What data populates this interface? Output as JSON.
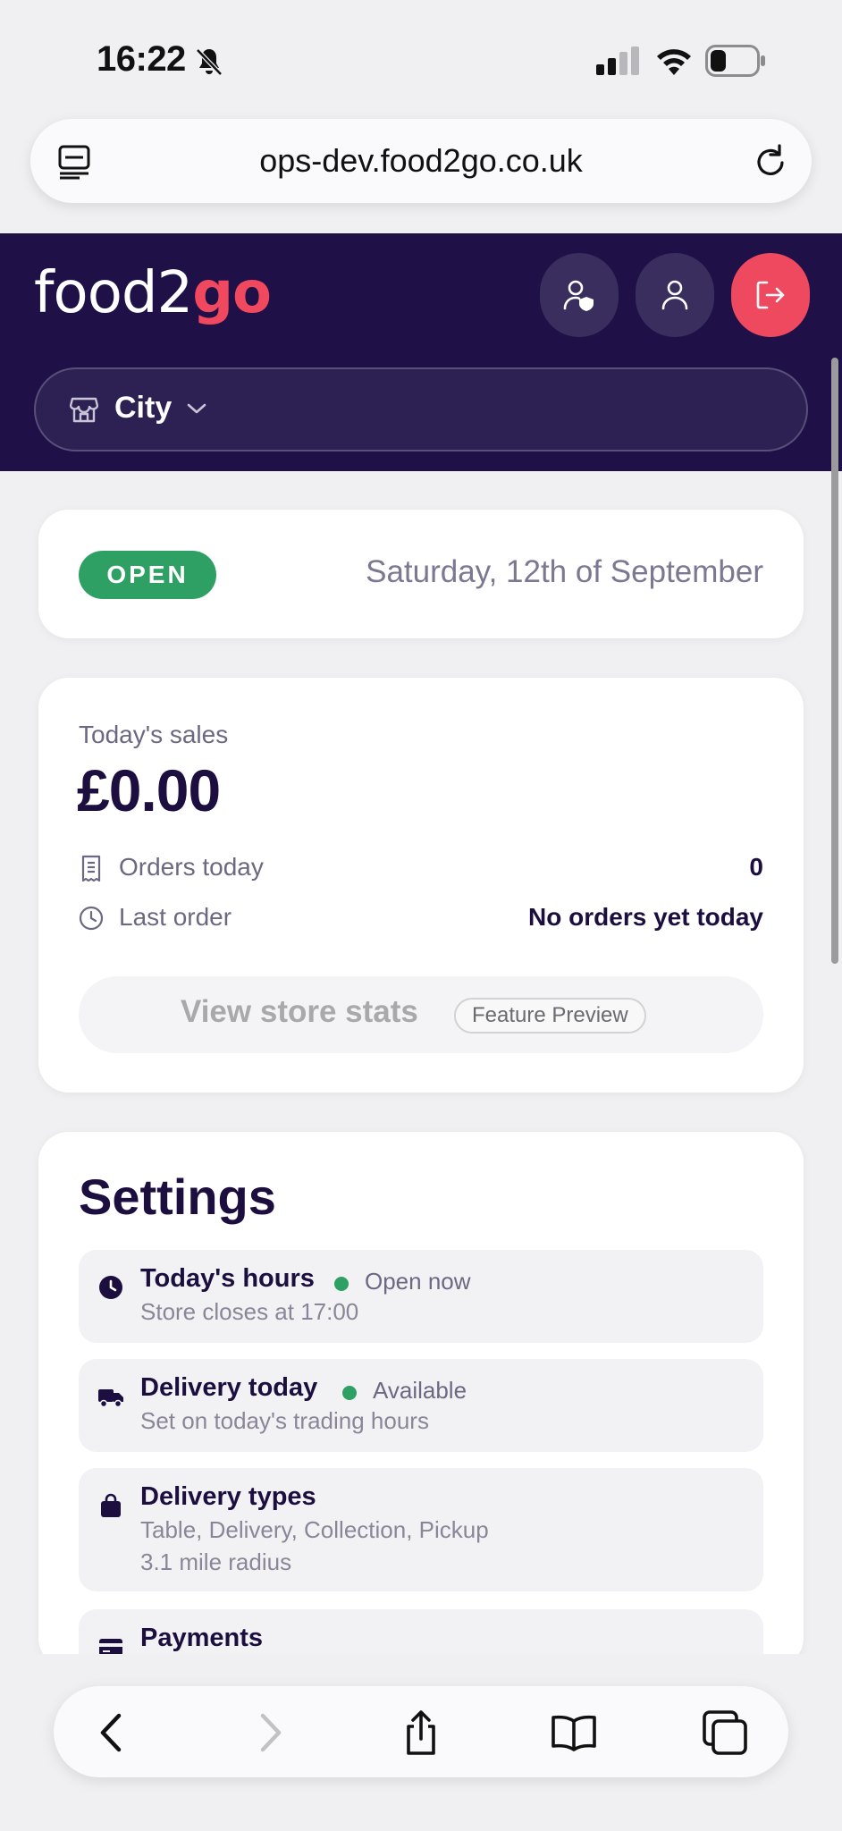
{
  "status_bar": {
    "time": "16:22",
    "battery_level": 0.35
  },
  "browser": {
    "url": "ops-dev.food2go.co.uk"
  },
  "header": {
    "logo_primary": "food2",
    "logo_accent": "go",
    "store_name": "City",
    "colors": {
      "background": "#1f1148",
      "accent": "#ef4960"
    }
  },
  "status_card": {
    "badge": "OPEN",
    "date": "Saturday, 12th of September",
    "badge_color": "#2ea063"
  },
  "sales": {
    "label": "Today's sales",
    "amount": "£0.00",
    "orders_label": "Orders today",
    "orders_value": "0",
    "last_order_label": "Last order",
    "last_order_value": "No orders yet today",
    "stats_button": "View store stats",
    "preview_badge": "Feature Preview"
  },
  "settings": {
    "title": "Settings",
    "items": [
      {
        "title": "Today's hours",
        "status": "Open now",
        "lines": [
          "Store closes at 17:00"
        ],
        "icon": "clock-icon"
      },
      {
        "title": "Delivery today",
        "status": "Available",
        "lines": [
          "Set on today's trading hours"
        ],
        "icon": "truck-icon"
      },
      {
        "title": "Delivery types",
        "status": "",
        "lines": [
          "Table, Delivery, Collection, Pickup",
          "3.1 mile radius"
        ],
        "icon": "bag-icon"
      },
      {
        "title": "Payments",
        "status": "",
        "lines": [],
        "icon": "card-icon"
      }
    ]
  }
}
